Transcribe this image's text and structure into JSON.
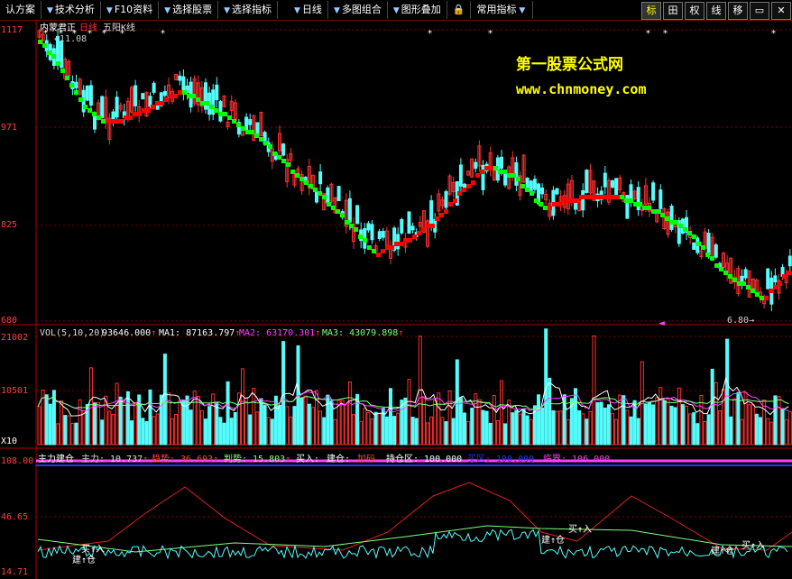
{
  "toolbar": {
    "items": [
      "认方案",
      "技术分析",
      "F10资料",
      "选择股票",
      "选择指标",
      "日线",
      "多图组合",
      "图形叠加",
      "常用指标"
    ],
    "lock_icon": "lock-icon",
    "right_buttons": [
      "标",
      "田",
      "权",
      "线",
      "移"
    ],
    "window_controls": [
      "min-icon",
      "close-icon"
    ]
  },
  "price_panel": {
    "stock_name": "内蒙君正",
    "period": "日线",
    "indicator": "五阳K线",
    "high_marker": "11.08",
    "low_marker": "6.80",
    "y_labels": [
      "1117",
      "971",
      "825",
      "680"
    ]
  },
  "watermark": {
    "line1": "第一股票公式网",
    "line2": "www.chnmoney.com"
  },
  "vol_panel": {
    "title": "VOL(5,10,20)",
    "value": "93646.000",
    "ma1_label": "MA1: 87163.797",
    "ma2_label": "MA2: 63170.301",
    "ma3_label": "MA3: 43079.898",
    "y_labels": [
      "21002",
      "10501",
      "X10"
    ]
  },
  "ind_panel": {
    "title": "主力建仓",
    "zhuli": "主力: 10.737",
    "qushi": "趋势: 36.693",
    "panshi": "判势: 15.803",
    "mairu": "买入:",
    "jiancang": "建仓:",
    "jiama": "加码",
    "chicang": "持仓区: 100.000",
    "blue_label": "买区: 100.000",
    "lingjie": "临界: 106.000",
    "y_labels": [
      "108.00",
      "46.65",
      "14.71"
    ],
    "buy_label": "买↑入",
    "build_label": "建↑仓"
  },
  "colors": {
    "up": "#ff3030",
    "down": "#54fcfc",
    "green": "#00ff00",
    "red": "#ff0000",
    "axis": "#b00000"
  }
}
